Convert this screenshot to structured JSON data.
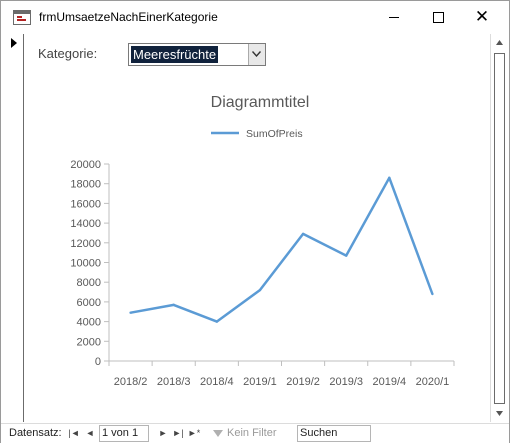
{
  "window": {
    "title": "frmUmsaetzeNachEinerKategorie"
  },
  "form": {
    "kategorie_label": "Kategorie:",
    "kategorie_value": "Meeresfrüchte"
  },
  "chart_data": {
    "type": "line",
    "title": "Diagrammtitel",
    "xlabel": "",
    "ylabel": "",
    "categories": [
      "2018/2",
      "2018/3",
      "2018/4",
      "2019/1",
      "2019/2",
      "2019/3",
      "2019/4",
      "2020/1"
    ],
    "series": [
      {
        "name": "SumOfPreis",
        "values": [
          4900,
          5700,
          4000,
          7200,
          12900,
          10700,
          18600,
          6800
        ]
      }
    ],
    "ylim": [
      0,
      20000
    ],
    "yticks": [
      0,
      2000,
      4000,
      6000,
      8000,
      10000,
      12000,
      14000,
      16000,
      18000,
      20000
    ],
    "grid": false,
    "legend": "top",
    "color": "#5b9bd5"
  },
  "navigation": {
    "label": "Datensatz:",
    "position": "1 von 1",
    "filter_label": "Kein Filter",
    "search_placeholder": "Suchen"
  }
}
